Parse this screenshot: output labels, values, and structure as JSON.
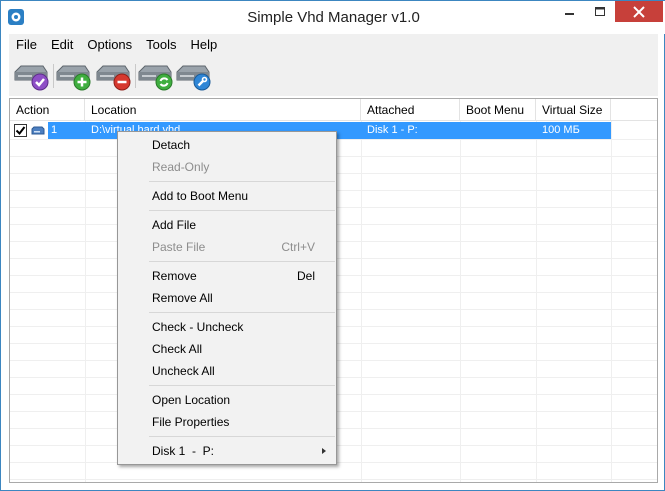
{
  "window": {
    "title": "Simple Vhd Manager v1.0"
  },
  "menu": [
    "File",
    "Edit",
    "Options",
    "Tools",
    "Help"
  ],
  "toolbar": {
    "buttons": [
      {
        "name": "attach-disk-button",
        "icon": "disk-check-icon"
      },
      {
        "name": "add-disk-button",
        "icon": "disk-add-icon"
      },
      {
        "name": "remove-disk-button",
        "icon": "disk-remove-icon"
      },
      {
        "name": "refresh-disk-button",
        "icon": "disk-refresh-icon"
      },
      {
        "name": "disk-settings-button",
        "icon": "disk-wrench-icon"
      }
    ]
  },
  "table": {
    "columns": [
      "Action",
      "Location",
      "Attached",
      "Boot Menu",
      "Virtual Size"
    ],
    "rows": [
      {
        "checked": true,
        "number": "1",
        "location": "D:\\virtual hard.vhd",
        "attached": "Disk 1  -  P:",
        "boot_menu": "",
        "virtual_size": "100 МБ"
      }
    ]
  },
  "context_menu": {
    "items": [
      {
        "label": "Detach",
        "enabled": true
      },
      {
        "label": "Read-Only",
        "enabled": false
      },
      {
        "label": "Add to Boot Menu",
        "enabled": true
      },
      {
        "label": "Add File",
        "enabled": true
      },
      {
        "label": "Paste File",
        "enabled": false,
        "shortcut": "Ctrl+V"
      },
      {
        "label": "Remove",
        "enabled": true,
        "shortcut": "Del"
      },
      {
        "label": "Remove All",
        "enabled": true
      },
      {
        "label": "Check - Uncheck",
        "enabled": true
      },
      {
        "label": "Check All",
        "enabled": true
      },
      {
        "label": "Uncheck All",
        "enabled": true
      },
      {
        "label": "Open Location",
        "enabled": true
      },
      {
        "label": "File Properties",
        "enabled": true
      },
      {
        "label": "Disk 1  -  P:",
        "enabled": true,
        "submenu": true
      }
    ]
  },
  "colors": {
    "selection": "#3399ff",
    "close_button": "#c7403a",
    "menu_background": "#f0f0f0"
  }
}
